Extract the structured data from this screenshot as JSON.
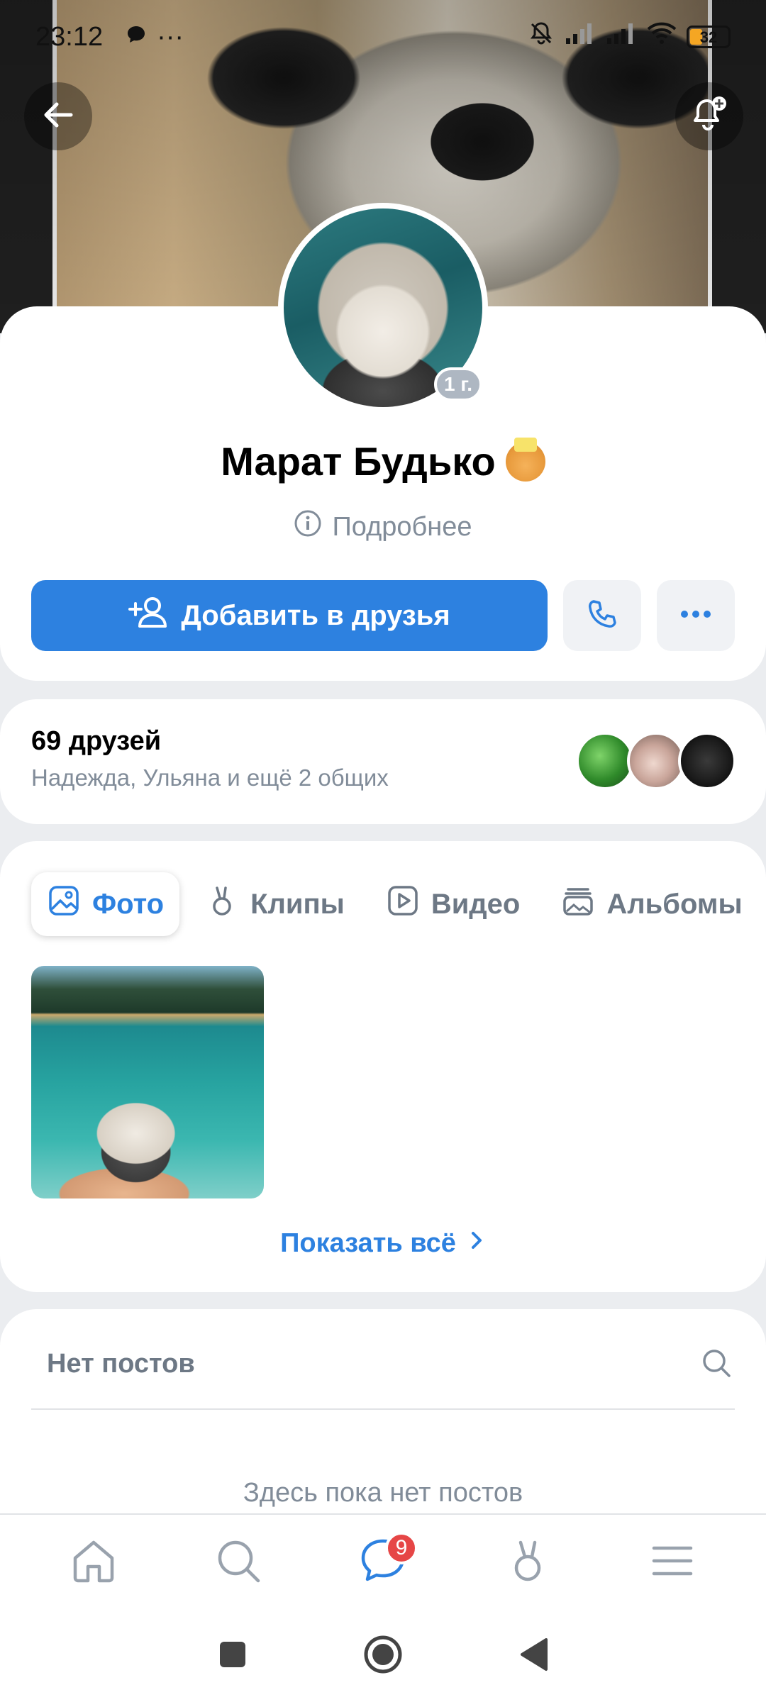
{
  "status_bar": {
    "time": "23:12",
    "more": "···",
    "battery": "32"
  },
  "profile": {
    "age_badge": "1 г.",
    "name": "Марат Будько",
    "more_info": "Подробнее",
    "add_friend": "Добавить в друзья"
  },
  "friends": {
    "title": "69 друзей",
    "subtitle": "Надежда, Ульяна и ещё 2 общих"
  },
  "media": {
    "tabs": [
      {
        "label": "Фото",
        "icon": "photo-icon",
        "active": true
      },
      {
        "label": "Клипы",
        "icon": "clips-icon"
      },
      {
        "label": "Видео",
        "icon": "video-icon"
      },
      {
        "label": "Альбомы",
        "icon": "albums-icon"
      }
    ],
    "show_all": "Показать всё"
  },
  "posts": {
    "header": "Нет постов",
    "empty": "Здесь пока нет постов"
  },
  "tabbar": {
    "messages_badge": "9"
  },
  "colors": {
    "accent": "#2d81e0",
    "badge": "#e64646",
    "muted": "#818c99"
  }
}
